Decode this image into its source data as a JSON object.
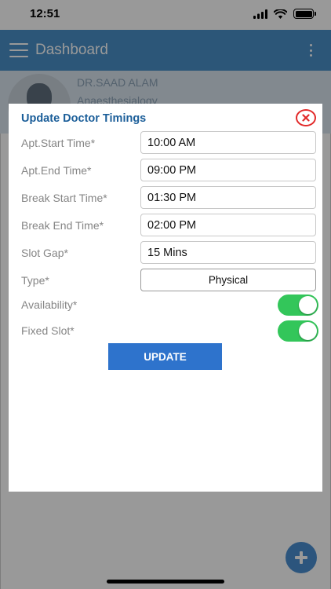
{
  "status_bar": {
    "time": "12:51"
  },
  "app_bar": {
    "title": "Dashboard"
  },
  "profile": {
    "name": "DR.SAAD ALAM",
    "specialty": "Anaesthesialogy"
  },
  "dialog": {
    "title": "Update Doctor Timings",
    "fields": [
      {
        "label": "Apt.Start Time*",
        "value": "10:00 AM"
      },
      {
        "label": "Apt.End Time*",
        "value": "09:00 PM"
      },
      {
        "label": "Break Start Time*",
        "value": "01:30 PM"
      },
      {
        "label": "Break End Time*",
        "value": "02:00 PM"
      },
      {
        "label": "Slot Gap*",
        "value": "15 Mins"
      }
    ],
    "type": {
      "label": "Type*",
      "value": "Physical"
    },
    "availability": {
      "label": "Availability*",
      "on": true
    },
    "fixed_slot": {
      "label": "Fixed Slot*",
      "on": true
    },
    "update_label": "UPDATE"
  },
  "colors": {
    "app_bar": "#4a90c8",
    "dialog_title": "#1b5e99",
    "close": "#e22a2a",
    "toggle_on": "#33c65a",
    "update_button": "#2e73cc",
    "fab": "#4a8ed0"
  },
  "icons": {
    "menu": "hamburger-icon",
    "more": "kebab-icon",
    "close": "close-circle-icon",
    "fab": "plus-icon",
    "wifi": "wifi-icon",
    "signal": "signal-icon",
    "battery": "battery-icon"
  }
}
